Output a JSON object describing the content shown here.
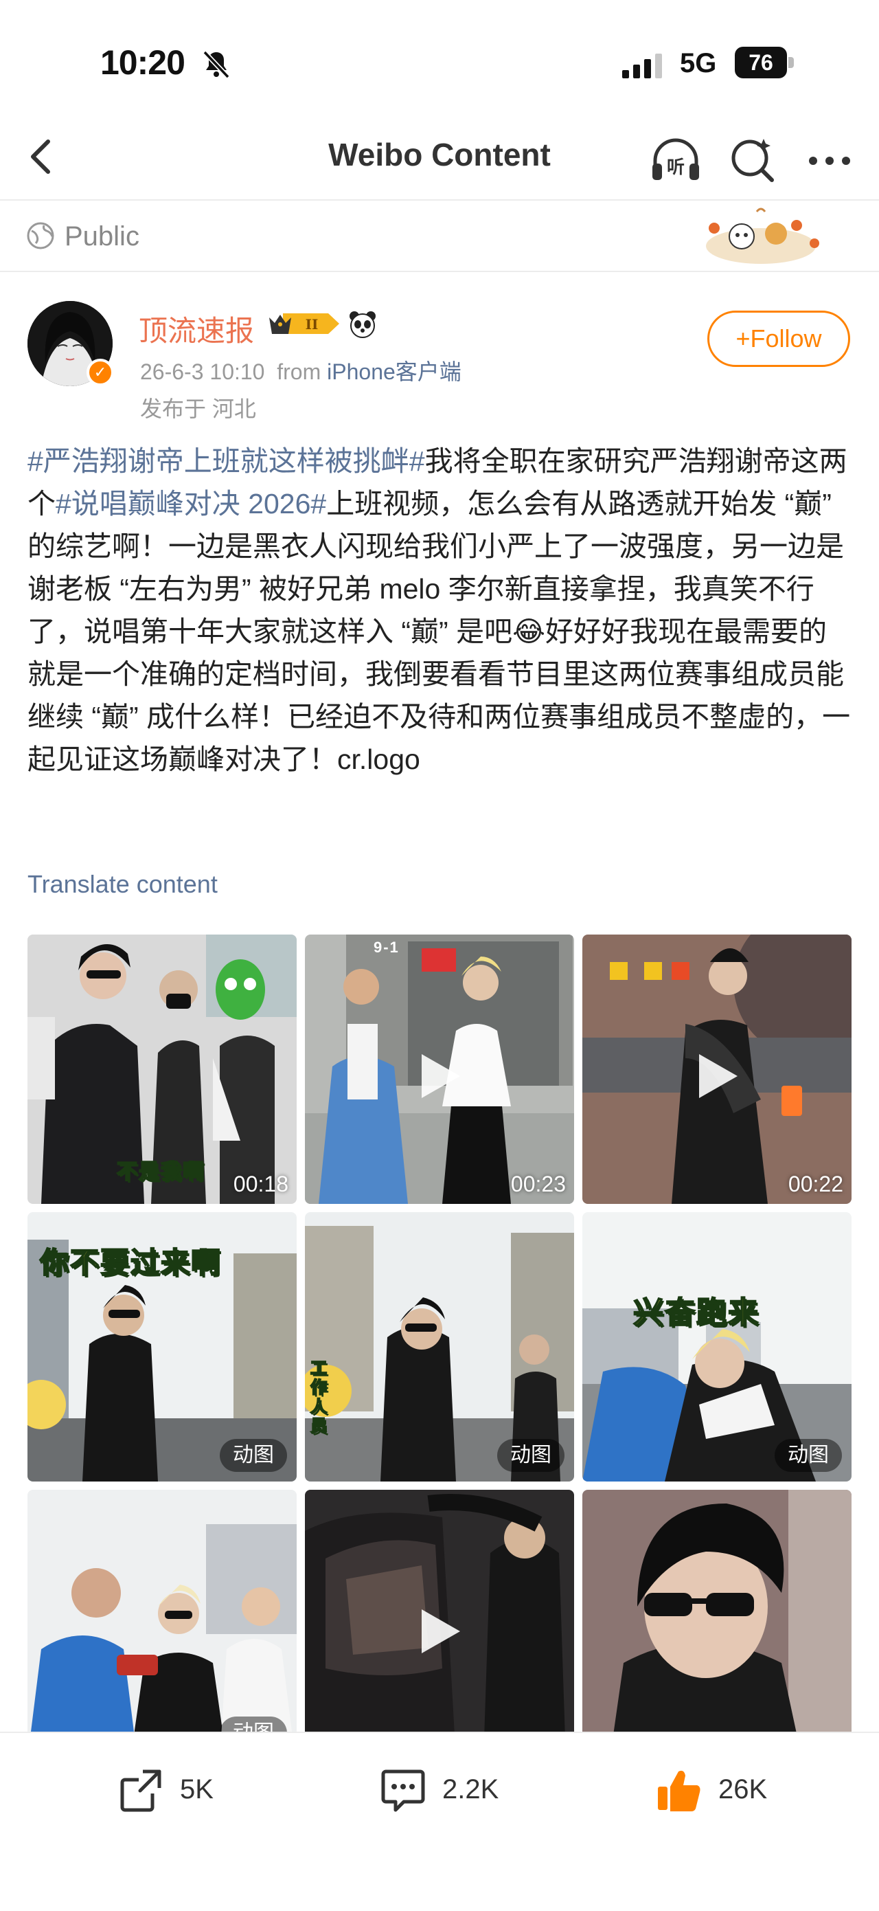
{
  "status_bar": {
    "time": "10:20",
    "network": "5G",
    "battery": "76"
  },
  "nav": {
    "title": "Weibo Content",
    "listen_icon_text": "听"
  },
  "visibility": {
    "label": "Public"
  },
  "author": {
    "name": "顶流速报",
    "level_badge": "II",
    "timestamp": "26-6-3 10:10",
    "from_label": "from",
    "source": "iPhone客户端",
    "location": "发布于 河北",
    "follow_label": "+Follow"
  },
  "post": {
    "tag1": "#严浩翔谢帝上班就这样被挑衅#",
    "text1": "我将全职在家研究严浩翔谢帝这两个",
    "tag2": "#说唱巅峰对决 2026#",
    "text2": "上班视频，怎么会有从路透就开始发 “巅” 的综艺啊！一边是黑衣人闪现给我们小严上了一波强度，另一边是谢老板 “左右为男” 被好兄弟 melo 李尔新直接拿捏，我真笑不行了，说唱第十年大家就这样入 “巅” 是吧",
    "emoji": "😂",
    "text3": "好好好我现在最需要的就是一个准确的定档时间，我倒要看看节目里这两位赛事组成员能继续 “巅” 成什么样！已经迫不及待和两位赛事组成员不整虚的，一起见证这场巅峰对决了！cr.logo",
    "translate_label": "Translate content"
  },
  "media": [
    {
      "kind": "video",
      "duration": "00:18",
      "caption": "不是我啊"
    },
    {
      "kind": "video",
      "duration": "00:23",
      "caption": "9-1"
    },
    {
      "kind": "video",
      "duration": "00:22",
      "caption": ""
    },
    {
      "kind": "gif",
      "badge": "动图",
      "caption": "你不要过来啊"
    },
    {
      "kind": "gif",
      "badge": "动图",
      "caption": "工作人员"
    },
    {
      "kind": "gif",
      "badge": "动图",
      "caption": "兴奋跑来"
    },
    {
      "kind": "gif",
      "badge": "动图",
      "caption": ""
    },
    {
      "kind": "video",
      "duration": "",
      "caption": ""
    },
    {
      "kind": "image",
      "caption": ""
    }
  ],
  "actions": {
    "share": "5K",
    "comment": "2.2K",
    "like": "26K"
  },
  "colors": {
    "accent": "#ff8200",
    "link": "#5b7397",
    "name": "#eb7350"
  }
}
